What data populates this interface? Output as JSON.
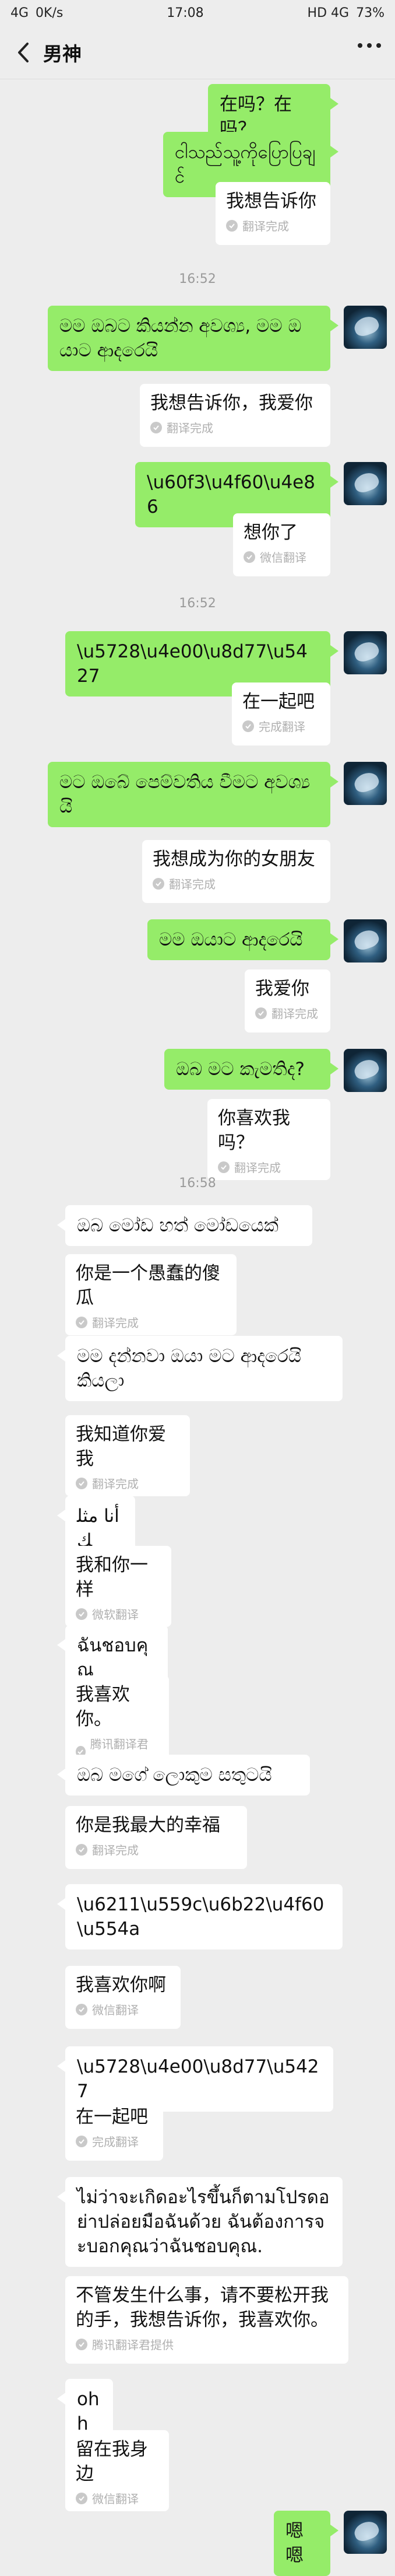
{
  "status_bar": {
    "network": "4G",
    "speed": "0K/s",
    "time": "17:08",
    "right_indicators": "HD 4G",
    "battery": "73%"
  },
  "header": {
    "title": "男神"
  },
  "messages": [
    {
      "type": "me",
      "text": "在吗？在吗？"
    },
    {
      "type": "me",
      "text": "ငါသည်သူ့ကိုပြောပြချင်"
    },
    {
      "type": "translation",
      "text": "我想告诉你",
      "note": "翻译完成"
    },
    {
      "type": "time",
      "text": "16:52"
    },
    {
      "type": "me",
      "text": "මම ඔබට කියන්න අවශ්‍ය, මම ඔයාට ආදරෙයි"
    },
    {
      "type": "translation",
      "text": "我想告诉你，我爱你",
      "note": "翻译完成"
    },
    {
      "type": "me",
      "text": "\\u60f3\\u4f60\\u4e86"
    },
    {
      "type": "translation",
      "text": "想你了",
      "note": "微信翻译"
    },
    {
      "type": "time",
      "text": "16:52"
    },
    {
      "type": "me",
      "text": "\\u5728\\u4e00\\u8d77\\u5427"
    },
    {
      "type": "translation",
      "text": "在一起吧",
      "note": "完成翻译"
    },
    {
      "type": "me",
      "text": "මට ඔබේ පෙම්වතිය වීමට අවශ්‍යයි"
    },
    {
      "type": "translation",
      "text": "我想成为你的女朋友",
      "note": "翻译完成"
    },
    {
      "type": "me",
      "text": "මම ඔයාට ආදරෙයි"
    },
    {
      "type": "translation",
      "text": "我爱你",
      "note": "翻译完成"
    },
    {
      "type": "me",
      "text": "ඔබ මට කැමතිද?"
    },
    {
      "type": "translation",
      "text": "你喜欢我吗？",
      "note": "翻译完成"
    },
    {
      "type": "time",
      "text": "16:58"
    },
    {
      "type": "other",
      "text": "ඔබ මෝඩ හත් මෝඩයෙක්"
    },
    {
      "type": "translation",
      "text": "你是一个愚蠢的傻瓜",
      "note": "翻译完成"
    },
    {
      "type": "other",
      "text": "මම දන්නවා ඔයා මට ආදරෙයි කියලා"
    },
    {
      "type": "translation",
      "text": "我知道你爱我",
      "note": "翻译完成"
    },
    {
      "type": "other",
      "text": "أنا مثلك"
    },
    {
      "type": "translation",
      "text": "我和你一样",
      "note": "微软翻译"
    },
    {
      "type": "other",
      "text": "ฉันชอบคุณ"
    },
    {
      "type": "translation",
      "text": "我喜欢你。",
      "note": "腾讯翻译君提供"
    },
    {
      "type": "other",
      "text": "ඔබ මගේ ලොකුම සතුටයි"
    },
    {
      "type": "translation",
      "text": "你是我最大的幸福",
      "note": "翻译完成"
    },
    {
      "type": "other",
      "text": "\\u6211\\u559c\\u6b22\\u4f60\\u554a"
    },
    {
      "type": "translation",
      "text": "我喜欢你啊",
      "note": "微信翻译"
    },
    {
      "type": "other",
      "text": "\\u5728\\u4e00\\u8d77\\u5427"
    },
    {
      "type": "translation",
      "text": "在一起吧",
      "note": "完成翻译"
    },
    {
      "type": "other",
      "text": "ไม่ว่าจะเกิดอะไรขึ้นก็ตามโปรดอย่าปล่อยมือฉันด้วย ฉันต้องการจะบอกคุณว่าฉันชอบคุณ."
    },
    {
      "type": "translation",
      "text": "不管发生什么事，请不要松开我的手，我想告诉你，我喜欢你。",
      "note": "腾讯翻译君提供"
    },
    {
      "type": "other",
      "text": "ohh"
    },
    {
      "type": "translation",
      "text": "留在我身边",
      "note": "微信翻译"
    },
    {
      "type": "me",
      "text": "嗯嗯"
    }
  ]
}
